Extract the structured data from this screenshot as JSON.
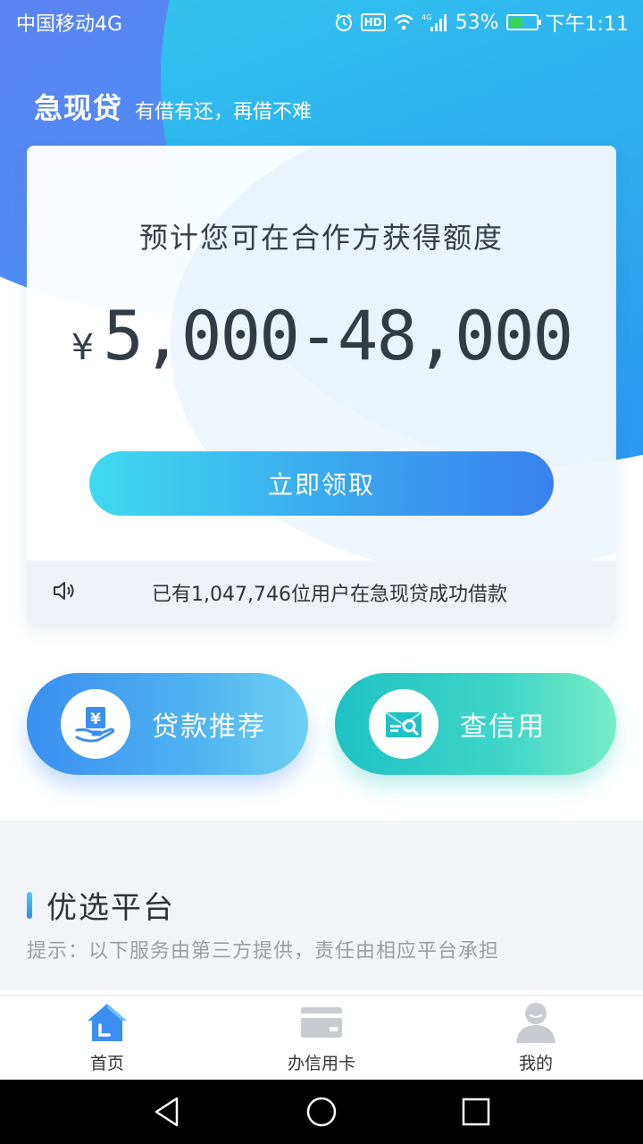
{
  "status_bar": {
    "carrier": "中国移动4G",
    "network_badge": "4G",
    "battery_percent": "53%",
    "battery_level": 0.53,
    "time": "下午1:11",
    "icons": [
      "alarm-icon",
      "hd-icon",
      "wifi-icon",
      "signal-icon",
      "battery-icon"
    ]
  },
  "header": {
    "title": "急现贷",
    "slogan": "有借有还，再借不难"
  },
  "quota_card": {
    "title": "预计您可在合作方获得额度",
    "currency": "¥",
    "range": "5,000-48,000",
    "button_label": "立即领取",
    "notice": "已有1,047,746位用户在急现贷成功借款"
  },
  "actions": [
    {
      "label": "贷款推荐",
      "icon": "loan-hand-icon"
    },
    {
      "label": "查信用",
      "icon": "credit-report-icon"
    }
  ],
  "section": {
    "title": "优选平台",
    "hint": "提示：以下服务由第三方提供，责任由相应平台承担"
  },
  "bottom_nav": {
    "items": [
      {
        "label": "首页",
        "icon": "home-icon",
        "active": true
      },
      {
        "label": "办信用卡",
        "icon": "credit-card-icon",
        "active": false
      },
      {
        "label": "我的",
        "icon": "profile-icon",
        "active": false
      }
    ]
  },
  "colors": {
    "accent_blue": "#3a8ff0",
    "accent_cyan": "#3fdaf0",
    "accent_teal": "#1fc1c4",
    "nav_active": "#3a8ff0",
    "nav_inactive": "#c8cbd0"
  }
}
